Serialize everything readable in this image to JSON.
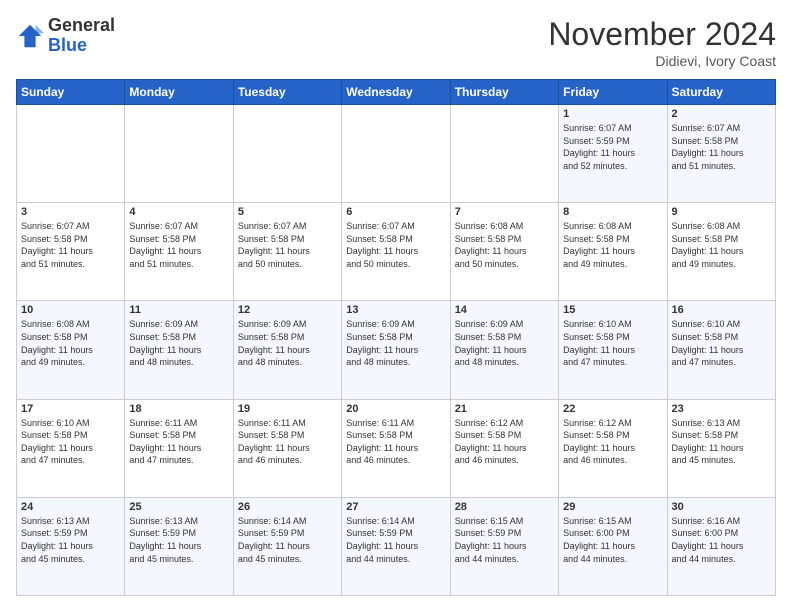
{
  "header": {
    "logo_general": "General",
    "logo_blue": "Blue",
    "month_title": "November 2024",
    "location": "Didievi, Ivory Coast"
  },
  "weekdays": [
    "Sunday",
    "Monday",
    "Tuesday",
    "Wednesday",
    "Thursday",
    "Friday",
    "Saturday"
  ],
  "weeks": [
    [
      {
        "day": "",
        "info": ""
      },
      {
        "day": "",
        "info": ""
      },
      {
        "day": "",
        "info": ""
      },
      {
        "day": "",
        "info": ""
      },
      {
        "day": "",
        "info": ""
      },
      {
        "day": "1",
        "info": "Sunrise: 6:07 AM\nSunset: 5:59 PM\nDaylight: 11 hours\nand 52 minutes."
      },
      {
        "day": "2",
        "info": "Sunrise: 6:07 AM\nSunset: 5:58 PM\nDaylight: 11 hours\nand 51 minutes."
      }
    ],
    [
      {
        "day": "3",
        "info": "Sunrise: 6:07 AM\nSunset: 5:58 PM\nDaylight: 11 hours\nand 51 minutes."
      },
      {
        "day": "4",
        "info": "Sunrise: 6:07 AM\nSunset: 5:58 PM\nDaylight: 11 hours\nand 51 minutes."
      },
      {
        "day": "5",
        "info": "Sunrise: 6:07 AM\nSunset: 5:58 PM\nDaylight: 11 hours\nand 50 minutes."
      },
      {
        "day": "6",
        "info": "Sunrise: 6:07 AM\nSunset: 5:58 PM\nDaylight: 11 hours\nand 50 minutes."
      },
      {
        "day": "7",
        "info": "Sunrise: 6:08 AM\nSunset: 5:58 PM\nDaylight: 11 hours\nand 50 minutes."
      },
      {
        "day": "8",
        "info": "Sunrise: 6:08 AM\nSunset: 5:58 PM\nDaylight: 11 hours\nand 49 minutes."
      },
      {
        "day": "9",
        "info": "Sunrise: 6:08 AM\nSunset: 5:58 PM\nDaylight: 11 hours\nand 49 minutes."
      }
    ],
    [
      {
        "day": "10",
        "info": "Sunrise: 6:08 AM\nSunset: 5:58 PM\nDaylight: 11 hours\nand 49 minutes."
      },
      {
        "day": "11",
        "info": "Sunrise: 6:09 AM\nSunset: 5:58 PM\nDaylight: 11 hours\nand 48 minutes."
      },
      {
        "day": "12",
        "info": "Sunrise: 6:09 AM\nSunset: 5:58 PM\nDaylight: 11 hours\nand 48 minutes."
      },
      {
        "day": "13",
        "info": "Sunrise: 6:09 AM\nSunset: 5:58 PM\nDaylight: 11 hours\nand 48 minutes."
      },
      {
        "day": "14",
        "info": "Sunrise: 6:09 AM\nSunset: 5:58 PM\nDaylight: 11 hours\nand 48 minutes."
      },
      {
        "day": "15",
        "info": "Sunrise: 6:10 AM\nSunset: 5:58 PM\nDaylight: 11 hours\nand 47 minutes."
      },
      {
        "day": "16",
        "info": "Sunrise: 6:10 AM\nSunset: 5:58 PM\nDaylight: 11 hours\nand 47 minutes."
      }
    ],
    [
      {
        "day": "17",
        "info": "Sunrise: 6:10 AM\nSunset: 5:58 PM\nDaylight: 11 hours\nand 47 minutes."
      },
      {
        "day": "18",
        "info": "Sunrise: 6:11 AM\nSunset: 5:58 PM\nDaylight: 11 hours\nand 47 minutes."
      },
      {
        "day": "19",
        "info": "Sunrise: 6:11 AM\nSunset: 5:58 PM\nDaylight: 11 hours\nand 46 minutes."
      },
      {
        "day": "20",
        "info": "Sunrise: 6:11 AM\nSunset: 5:58 PM\nDaylight: 11 hours\nand 46 minutes."
      },
      {
        "day": "21",
        "info": "Sunrise: 6:12 AM\nSunset: 5:58 PM\nDaylight: 11 hours\nand 46 minutes."
      },
      {
        "day": "22",
        "info": "Sunrise: 6:12 AM\nSunset: 5:58 PM\nDaylight: 11 hours\nand 46 minutes."
      },
      {
        "day": "23",
        "info": "Sunrise: 6:13 AM\nSunset: 5:58 PM\nDaylight: 11 hours\nand 45 minutes."
      }
    ],
    [
      {
        "day": "24",
        "info": "Sunrise: 6:13 AM\nSunset: 5:59 PM\nDaylight: 11 hours\nand 45 minutes."
      },
      {
        "day": "25",
        "info": "Sunrise: 6:13 AM\nSunset: 5:59 PM\nDaylight: 11 hours\nand 45 minutes."
      },
      {
        "day": "26",
        "info": "Sunrise: 6:14 AM\nSunset: 5:59 PM\nDaylight: 11 hours\nand 45 minutes."
      },
      {
        "day": "27",
        "info": "Sunrise: 6:14 AM\nSunset: 5:59 PM\nDaylight: 11 hours\nand 44 minutes."
      },
      {
        "day": "28",
        "info": "Sunrise: 6:15 AM\nSunset: 5:59 PM\nDaylight: 11 hours\nand 44 minutes."
      },
      {
        "day": "29",
        "info": "Sunrise: 6:15 AM\nSunset: 6:00 PM\nDaylight: 11 hours\nand 44 minutes."
      },
      {
        "day": "30",
        "info": "Sunrise: 6:16 AM\nSunset: 6:00 PM\nDaylight: 11 hours\nand 44 minutes."
      }
    ]
  ]
}
